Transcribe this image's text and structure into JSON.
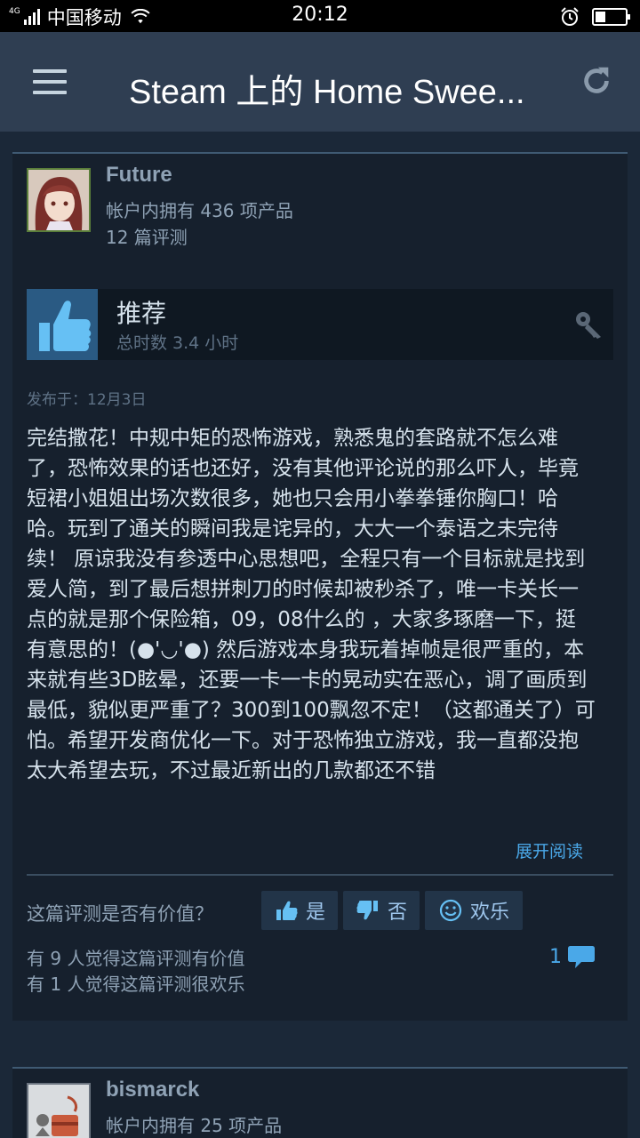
{
  "status_bar": {
    "network": "4G",
    "carrier": "中国移动",
    "time": "20:12",
    "battery_level": 0.33
  },
  "header": {
    "title": "Steam 上的 Home Swee..."
  },
  "review": {
    "user": {
      "name": "Future",
      "products": "帐户内拥有 436 项产品",
      "reviews": "12 篇评测"
    },
    "verdict": "推荐",
    "hours": "总时数 3.4 小时",
    "posted": "发布于：12月3日",
    "body": "完结撒花！中规中矩的恐怖游戏，熟悉鬼的套路就不怎么难了，恐怖效果的话也还好，没有其他评论说的那么吓人，毕竟短裙小姐姐出场次数很多，她也只会用小拳拳锤你胸口！哈哈。玩到了通关的瞬间我是诧异的，大大一个泰语之未完待续！ 原谅我没有参透中心思想吧，全程只有一个目标就是找到爱人简，到了最后想拼刺刀的时候却被秒杀了，唯一卡关长一点的就是那个保险箱，09，08什么的 ，大家多琢磨一下，挺有意思的！(●'◡'●) 然后游戏本身我玩着掉帧是很严重的，本来就有些3D眩晕，还要一卡一卡的晃动实在恶心，调了画质到最低，貌似更严重了？300到100飘忽不定！（这都通关了）可怕。希望开发商优化一下。对于恐怖独立游戏，我一直都没抱太大希望去玩，不过最近新出的几款都还不错",
    "expand_label": "展开阅读",
    "helpful_question": "这篇评测是否有价值？",
    "vote_yes": "是",
    "vote_no": "否",
    "vote_funny": "欢乐",
    "helpful_count": "有 9 人觉得这篇评测有价值",
    "funny_count": "有 1 人觉得这篇评测很欢乐",
    "comment_count": "1"
  },
  "review2": {
    "user": {
      "name": "bismarck",
      "products": "帐户内拥有 25 项产品"
    }
  },
  "colors": {
    "background": "#1b2838",
    "header": "#2f3e52",
    "card": "#16202d",
    "accent_blue": "#4aa8e8",
    "thumb_box": "#2a5a83"
  }
}
